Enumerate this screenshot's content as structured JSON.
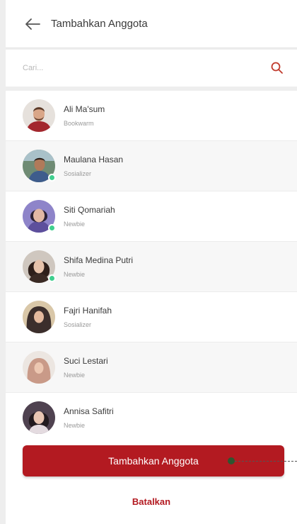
{
  "header": {
    "title": "Tambahkan Anggota",
    "back_icon": "arrow-left-icon"
  },
  "search": {
    "placeholder": "Cari...",
    "value": "",
    "icon": "search-icon",
    "accent": "#c0392b"
  },
  "members": [
    {
      "name": "Ali Ma'sum",
      "role": "Bookwarm",
      "online": false,
      "avatar": "person-avatar-bearded-man"
    },
    {
      "name": "Maulana Hasan",
      "role": "Sosializer",
      "online": true,
      "avatar": "person-avatar-man-outdoor"
    },
    {
      "name": "Siti Qomariah",
      "role": "Newbie",
      "online": true,
      "avatar": "person-avatar-young-woman"
    },
    {
      "name": "Shifa Medina Putri",
      "role": "Newbie",
      "online": true,
      "avatar": "person-avatar-woman-dark-hair"
    },
    {
      "name": "Fajri Hanifah",
      "role": "Sosializer",
      "online": false,
      "avatar": "person-avatar-woman-hijab"
    },
    {
      "name": "Suci Lestari",
      "role": "Newbie",
      "online": false,
      "avatar": "person-avatar-woman-hijab-pink"
    },
    {
      "name": "Annisa Safitri",
      "role": "Newbie",
      "online": false,
      "avatar": "person-avatar-woman-portrait"
    }
  ],
  "actions": {
    "add_label": "Tambahkan Anggota",
    "cancel_label": "Batalkan"
  },
  "colors": {
    "primary": "#b31a21",
    "online": "#3fcf8e",
    "background": "#eeeeee"
  }
}
